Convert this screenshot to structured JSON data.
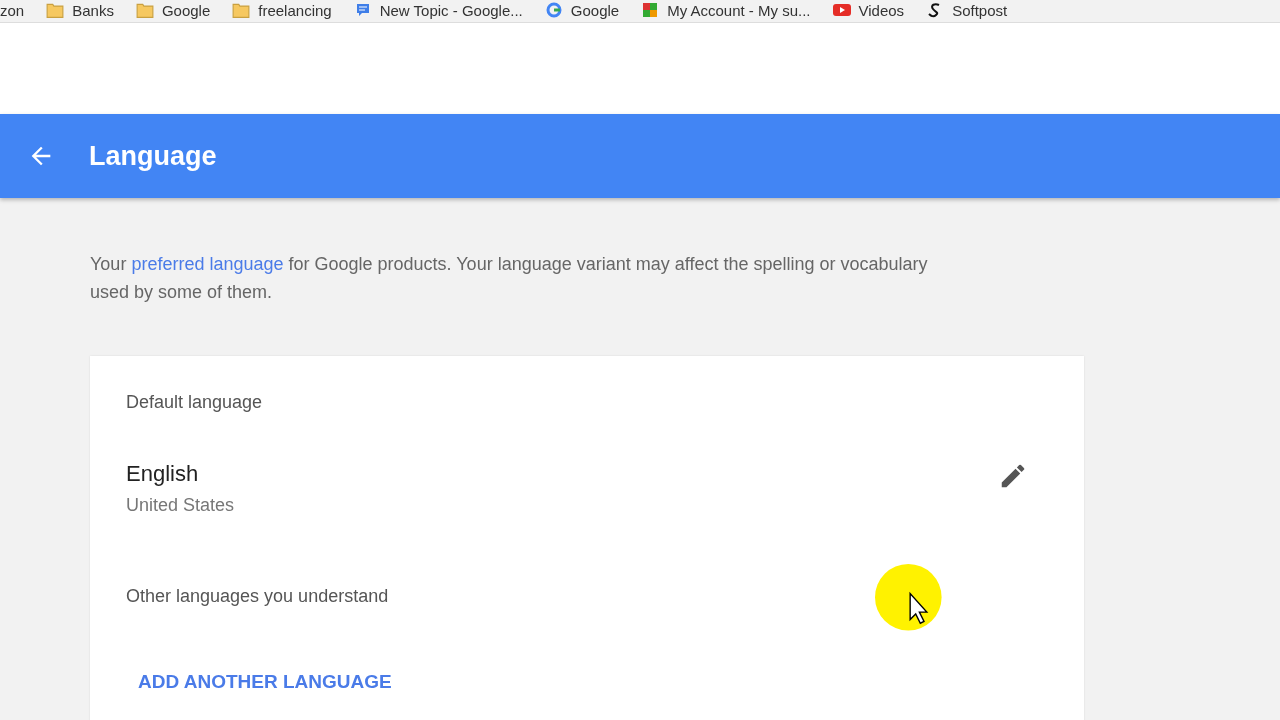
{
  "bookmarks": [
    {
      "label": "zon",
      "kind": "none"
    },
    {
      "label": "Banks",
      "kind": "folder"
    },
    {
      "label": "Google",
      "kind": "folder"
    },
    {
      "label": "freelancing",
      "kind": "folder"
    },
    {
      "label": "New Topic - Google...",
      "kind": "chat"
    },
    {
      "label": "Google",
      "kind": "g"
    },
    {
      "label": "My Account - My su...",
      "kind": "tiles"
    },
    {
      "label": "Videos",
      "kind": "video"
    },
    {
      "label": "Softpost",
      "kind": "s"
    }
  ],
  "header": {
    "title": "Language"
  },
  "intro": {
    "before": "Your ",
    "link": "preferred language",
    "after": " for Google products. Your language variant may affect the spelling or vocabulary used by some of them."
  },
  "card": {
    "default_heading": "Default language",
    "language": "English",
    "region": "United States",
    "other_heading": "Other languages you understand",
    "add_button": "ADD ANOTHER LANGUAGE"
  }
}
